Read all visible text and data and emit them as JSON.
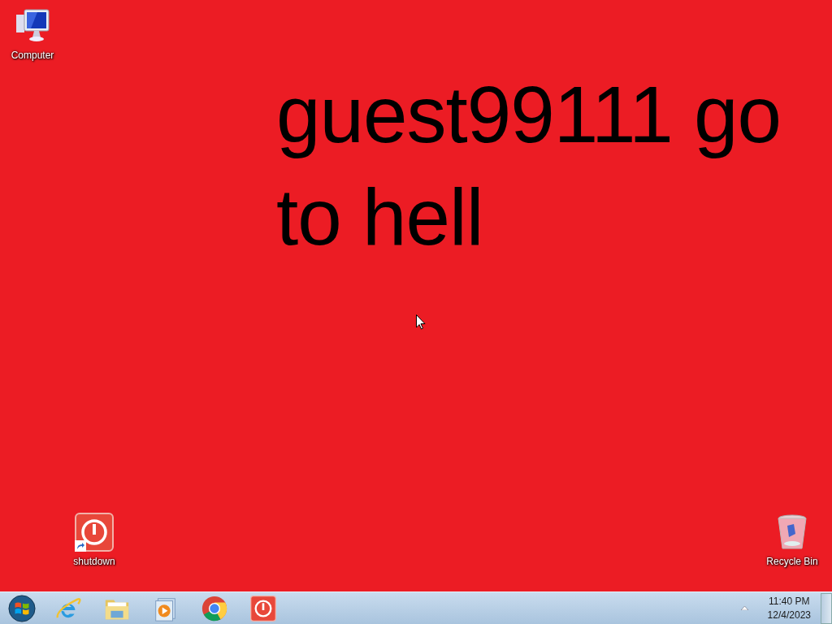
{
  "desktop": {
    "wallpaper_text": "guest99111 go to hell",
    "icons": [
      {
        "label": "Computer",
        "kind": "computer",
        "shortcut": false
      },
      {
        "label": "shutdown",
        "kind": "shutdown",
        "shortcut": true
      },
      {
        "label": "Recycle Bin",
        "kind": "recycle",
        "shortcut": false
      }
    ]
  },
  "taskbar": {
    "buttons": [
      {
        "kind": "start"
      },
      {
        "kind": "browser-e"
      },
      {
        "kind": "folder"
      },
      {
        "kind": "media"
      },
      {
        "kind": "chrome"
      },
      {
        "kind": "shutdown"
      }
    ],
    "clock": {
      "time": "11:40 PM",
      "date": "12/4/2023"
    }
  }
}
